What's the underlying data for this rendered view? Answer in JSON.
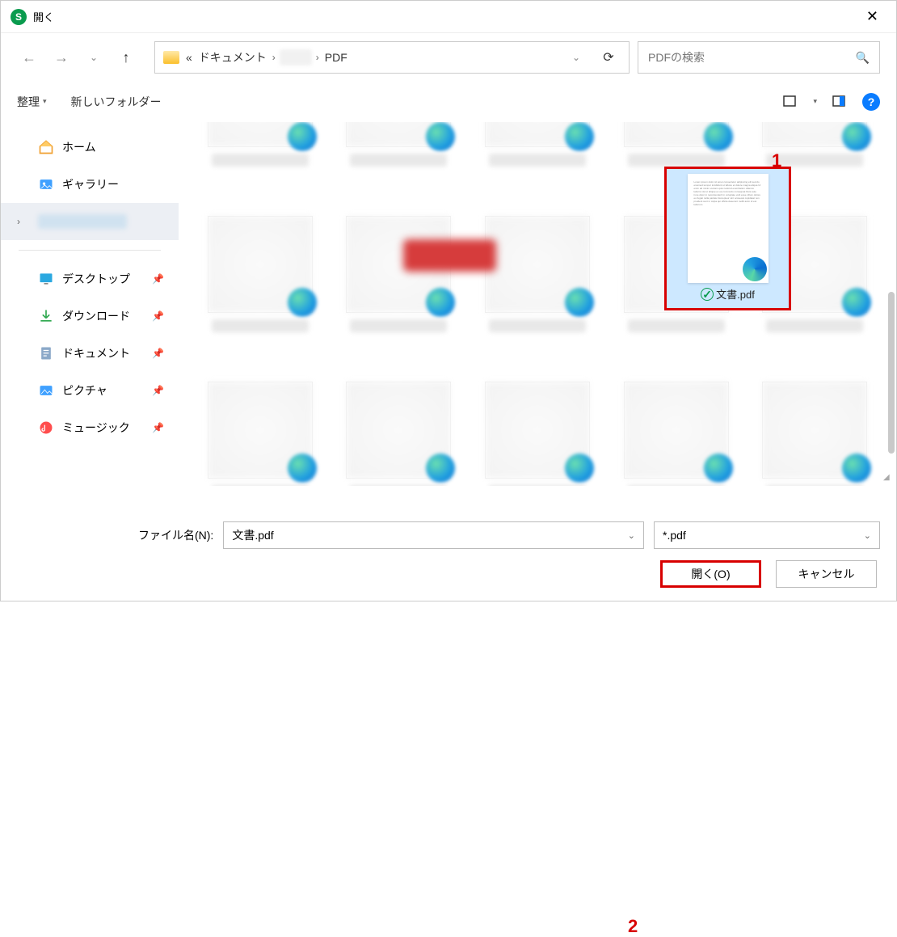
{
  "window": {
    "title": "開く",
    "app_icon_letter": "S"
  },
  "breadcrumb": {
    "prefix": "«",
    "seg1": "ドキュメント",
    "seg2": "PDF"
  },
  "search": {
    "placeholder": "PDFの検索"
  },
  "toolbar": {
    "organize": "整理",
    "new_folder": "新しいフォルダー"
  },
  "sidebar": {
    "home": "ホーム",
    "gallery": "ギャラリー",
    "desktop": "デスクトップ",
    "downloads": "ダウンロード",
    "documents": "ドキュメント",
    "pictures": "ピクチャ",
    "music": "ミュージック"
  },
  "selected_file": {
    "name": "文書.pdf"
  },
  "filename": {
    "label": "ファイル名(N):",
    "value": "文書.pdf"
  },
  "filetype": {
    "value": "*.pdf"
  },
  "buttons": {
    "open": "開く(O)",
    "cancel": "キャンセル"
  },
  "annotations": {
    "n1": "1",
    "n2": "2"
  }
}
